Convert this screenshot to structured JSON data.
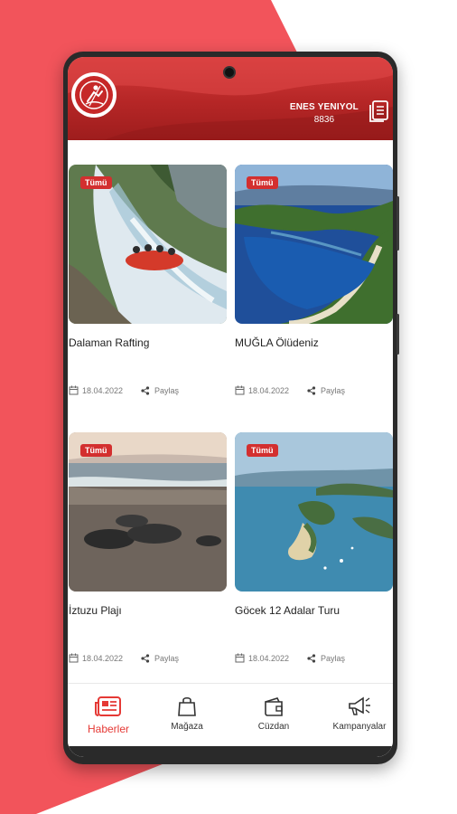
{
  "colors": {
    "brand_red": "#c62828",
    "accent_red": "#e53935",
    "background_red": "#f2545b"
  },
  "header": {
    "logo": "rafting-logo",
    "user_name": "ENES YENIYOL",
    "user_id": "8836",
    "menu_icon": "documents-icon"
  },
  "cards": [
    {
      "badge": "Tümü",
      "title": "Dalaman Rafting",
      "date": "18.04.2022",
      "share_label": "Paylaş",
      "image": "rafting-photo"
    },
    {
      "badge": "Tümü",
      "title": "MUĞLA Ölüdeniz",
      "date": "18.04.2022",
      "share_label": "Paylaş",
      "image": "lagoon-photo"
    },
    {
      "badge": "Tümü",
      "title": "İztuzu Plajı",
      "date": "18.04.2022",
      "share_label": "Paylaş",
      "image": "beach-turtles-photo"
    },
    {
      "badge": "Tümü",
      "title": "Göcek 12 Adalar Turu",
      "date": "18.04.2022",
      "share_label": "Paylaş",
      "image": "islands-photo"
    }
  ],
  "bottom_nav": [
    {
      "label": "Haberler",
      "icon": "news-icon",
      "active": true
    },
    {
      "label": "Mağaza",
      "icon": "shopping-bag-icon",
      "active": false
    },
    {
      "label": "Cüzdan",
      "icon": "wallet-icon",
      "active": false
    },
    {
      "label": "Kampanyalar",
      "icon": "megaphone-icon",
      "active": false
    }
  ]
}
